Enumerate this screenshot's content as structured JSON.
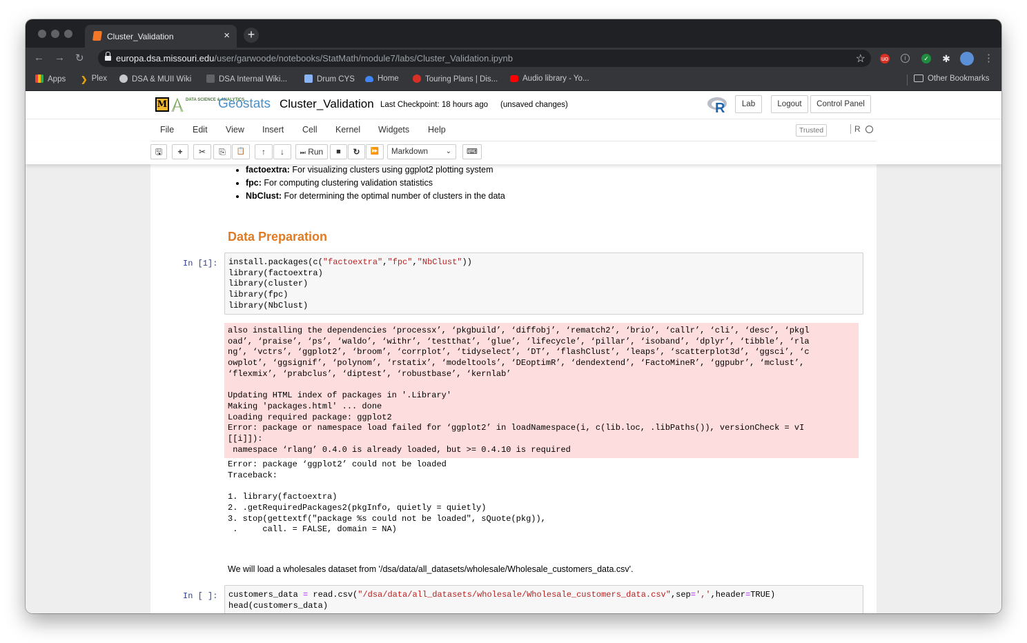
{
  "browser": {
    "tab_title": "Cluster_Validation",
    "tab_close": "×",
    "new_tab": "+",
    "url_host": "europa.dsa.missouri.edu",
    "url_path": "/user/garwoode/notebooks/StatMath/module7/labs/Cluster_Validation.ipynb",
    "back_glyph": "←",
    "forward_glyph": "→",
    "reload_glyph": "↻",
    "star_glyph": "☆",
    "menu_glyph": "⋮",
    "bookmarks": [
      {
        "label": "Apps",
        "icon": "apps-grid-icon",
        "color": "#ea4335"
      },
      {
        "label": "Plex",
        "icon": "plex-icon",
        "color": "#e5a00d"
      },
      {
        "label": "DSA & MUII Wiki",
        "icon": "wiki-icon",
        "color": "#c7c9cc"
      },
      {
        "label": "DSA Internal Wiki...",
        "icon": "wiki-doc-icon",
        "color": "#c7c9cc"
      },
      {
        "label": "Drum CYS",
        "icon": "drum-icon",
        "color": "#8ab4f8"
      },
      {
        "label": "Home",
        "icon": "cloud-icon",
        "color": "#4285f4"
      },
      {
        "label": "Touring Plans | Dis...",
        "icon": "touringplans-icon",
        "color": "#d93025"
      },
      {
        "label": "Audio library - Yo...",
        "icon": "youtube-icon",
        "color": "#ff0000"
      }
    ],
    "other_bookmarks": "Other Bookmarks"
  },
  "jupyter": {
    "brand": "Geostats",
    "ds_logo_text": "DATA SCIENCE & ANALYTICS",
    "mu_logo": "M",
    "notebook_name": "Cluster_Validation",
    "checkpoint": "Last Checkpoint: 18 hours ago",
    "unsaved": "(unsaved changes)",
    "header_buttons": {
      "lab": "Lab",
      "logout": "Logout",
      "control_panel": "Control Panel"
    },
    "menu": [
      "File",
      "Edit",
      "View",
      "Insert",
      "Cell",
      "Kernel",
      "Widgets",
      "Help"
    ],
    "trusted": "Trusted",
    "kernel_name": "R",
    "toolbar": {
      "save": "🖫",
      "add": "+",
      "cut": "✂",
      "copy": "⎘",
      "paste": "📋",
      "up": "↑",
      "down": "↓",
      "run": "Run",
      "run_glyph": "⏭",
      "stop": "■",
      "restart": "↻",
      "restart_run": "⏩",
      "cell_type": "Markdown",
      "keyboard": "⌨"
    }
  },
  "notebook": {
    "bullets": [
      {
        "bold": "factoextra:",
        "text": " For visualizing clusters using ggplot2 plotting system"
      },
      {
        "bold": "fpc:",
        "text": " For computing clustering validation statistics"
      },
      {
        "bold": "NbClust:",
        "text": " For determining the optimal number of clusters in the data"
      }
    ],
    "heading": "Data Preparation",
    "cell1": {
      "prompt": "In [1]:",
      "line1_a": "install.packages(c(",
      "line1_s1": "\"factoextra\"",
      "line1_c1": ",",
      "line1_s2": "\"fpc\"",
      "line1_c2": ",",
      "line1_s3": "\"NbClust\"",
      "line1_b": "))",
      "lines": [
        "library(factoextra)",
        "library(cluster)",
        "library(fpc)",
        "library(NbClust)"
      ]
    },
    "stderr_lines": [
      "also installing the dependencies ‘processx’, ‘pkgbuild’, ‘diffobj’, ‘rematch2’, ‘brio’, ‘callr’, ‘cli’, ‘desc’, ‘pkgl",
      "oad’, ‘praise’, ‘ps’, ‘waldo’, ‘withr’, ‘testthat’, ‘glue’, ‘lifecycle’, ‘pillar’, ‘isoband’, ‘dplyr’, ‘tibble’, ‘rla",
      "ng’, ‘vctrs’, ‘ggplot2’, ‘broom’, ‘corrplot’, ‘tidyselect’, ‘DT’, ‘flashClust’, ‘leaps’, ‘scatterplot3d’, ‘ggsci’, ‘c",
      "owplot’, ‘ggsignif’, ‘polynom’, ‘rstatix’, ‘modeltools’, ‘DEoptimR’, ‘dendextend’, ‘FactoMineR’, ‘ggpubr’, ‘mclust’,",
      "‘flexmix’, ‘prabclus’, ‘diptest’, ‘robustbase’, ‘kernlab’",
      "",
      "Updating HTML index of packages in '.Library'",
      "Making 'packages.html' ... done",
      "Loading required package: ggplot2",
      "Error: package or namespace load failed for ‘ggplot2’ in loadNamespace(i, c(lib.loc, .libPaths()), versionCheck = vI",
      "[[i]]):",
      " namespace ‘rlang’ 0.4.0 is already loaded, but >= 0.4.10 is required"
    ],
    "error_lines": [
      "Error: package ‘ggplot2’ could not be loaded",
      "Traceback:",
      "",
      "1. library(factoextra)",
      "2. .getRequiredPackages2(pkgInfo, quietly = quietly)",
      "3. stop(gettextf(\"package %s could not be loaded\", sQuote(pkg)), ",
      " .     call. = FALSE, domain = NA)"
    ],
    "paragraph": "We will load a wholesales dataset from '/dsa/data/all_datasets/wholesale/Wholesale_customers_data.csv'.",
    "cell2": {
      "prompt": "In [ ]:",
      "l1_a": "customers_data ",
      "l1_eq": "=",
      "l1_b": " read.csv(",
      "l1_s1": "\"/dsa/data/all_datasets/wholesale/Wholesale_customers_data.csv\"",
      "l1_c": ",sep",
      "l1_eq2": "=",
      "l1_s2": "','",
      "l1_d": ",header",
      "l1_eq3": "=",
      "l1_e": "TRUE)",
      "l2": "head(customers_data)"
    }
  }
}
